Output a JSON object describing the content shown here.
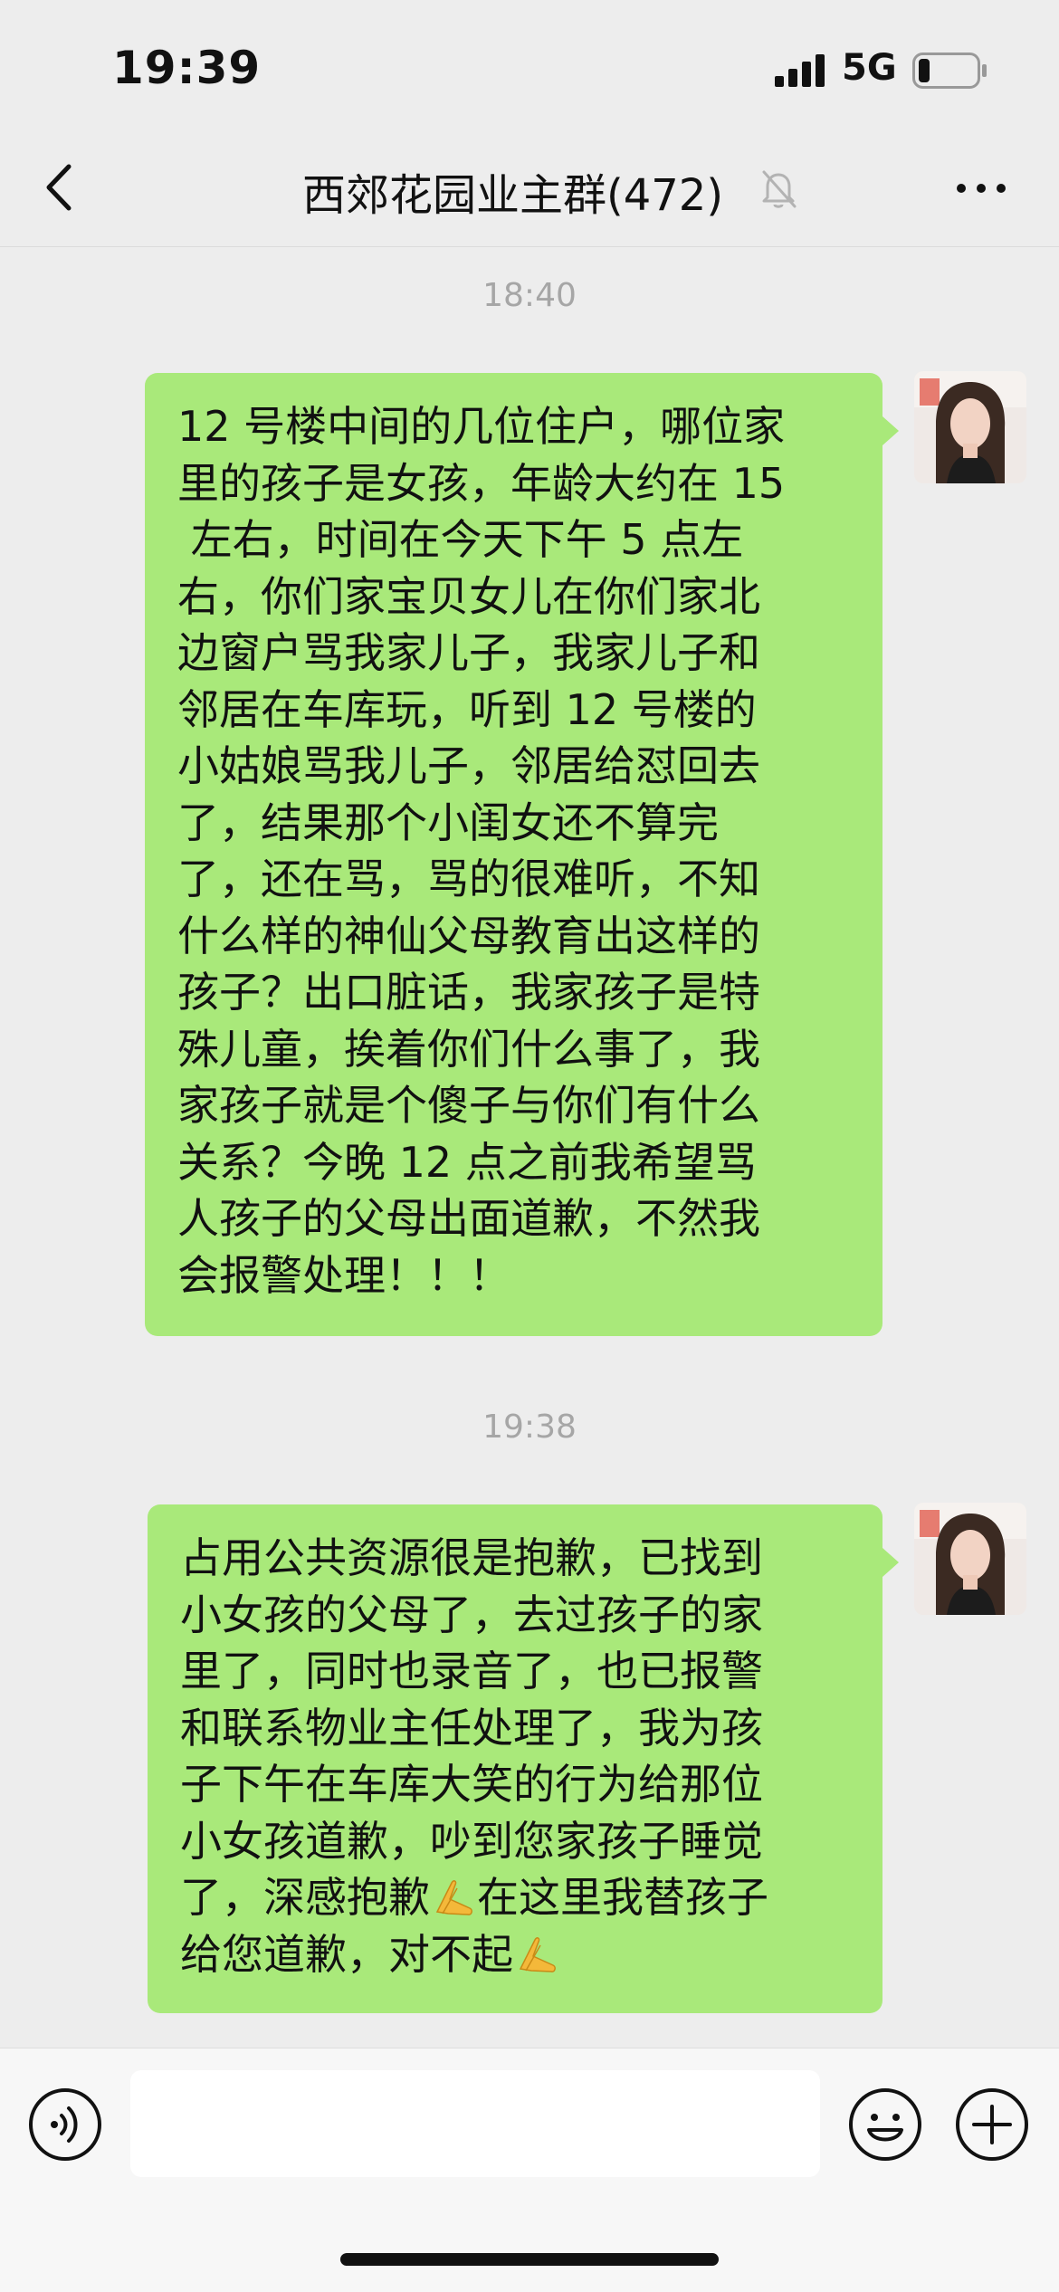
{
  "status_bar": {
    "time": "19:39",
    "network": "5G",
    "battery_level": 0.2
  },
  "nav": {
    "title": "西郊花园业主群(472)",
    "icons": [
      "chevron-left-icon",
      "bell-slash-icon",
      "more-dots-icon"
    ]
  },
  "messages": [
    {
      "timestamp": "18:40",
      "sender": "me",
      "lines": [
        "12 号楼中间的几位住户，哪位家",
        "里的孩子是女孩，年龄大约在 15",
        " 左右，时间在今天下午 5 点左",
        "右，你们家宝贝女儿在你们家北",
        "边窗户骂我家儿子，我家儿子和",
        "邻居在车库玩，听到 12 号楼的",
        "小姑娘骂我儿子，邻居给怼回去",
        "了，结果那个小闺女还不算完",
        "了，还在骂，骂的很难听，不知",
        "什么样的神仙父母教育出这样的",
        "孩子？出口脏话，我家孩子是特",
        "殊儿童，挨着你们什么事了，我",
        "家孩子就是个傻子与你们有什么",
        "关系？今晚 12 点之前我希望骂",
        "人孩子的父母出面道歉，不然我",
        "会报警处理！！！"
      ]
    },
    {
      "timestamp": "19:38",
      "sender": "me",
      "lines": [
        "占用公共资源很是抱歉，已找到",
        "小女孩的父母了，去过孩子的家",
        "里了，同时也录音了，也已报警",
        "和联系物业主任处理了，我为孩",
        "子下午在车库大笑的行为给那位",
        "小女孩道歉，吵到您家孩子睡觉",
        "了，深感抱歉",
        "在这里我替孩子",
        "给您道歉，对不起"
      ]
    }
  ],
  "input_bar": {
    "placeholder": "",
    "icons": [
      "voice-icon",
      "emoji-icon",
      "plus-icon"
    ]
  },
  "colors": {
    "background": "#ededed",
    "bubble_green": "#a9e97a",
    "timestamp_gray": "#a6a6a6",
    "input_bar_bg": "#f7f7f7"
  }
}
